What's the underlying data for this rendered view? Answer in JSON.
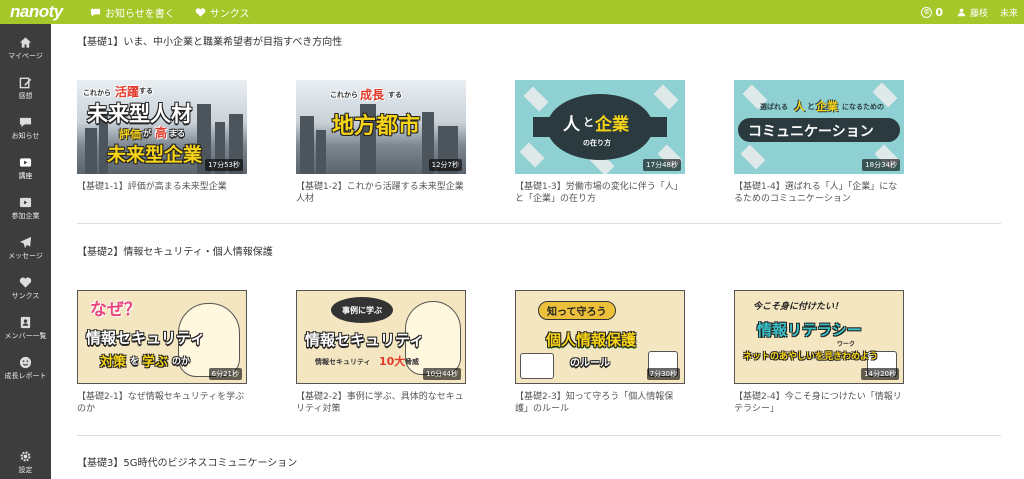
{
  "header": {
    "logo": "nanoty",
    "post_notice": "お知らせを書く",
    "thanks": "サンクス",
    "coin_symbol": "©",
    "coins": "0",
    "user_name": "藤枝",
    "user_extra": "未来"
  },
  "sidebar": {
    "items": [
      {
        "label": "マイページ",
        "icon": "home-icon"
      },
      {
        "label": "感想",
        "icon": "edit-icon"
      },
      {
        "label": "お知らせ",
        "icon": "chat-icon"
      },
      {
        "label": "講座",
        "icon": "play-icon"
      },
      {
        "label": "参加企業",
        "icon": "building-icon"
      },
      {
        "label": "メッセージ",
        "icon": "paper-plane-icon"
      },
      {
        "label": "サンクス",
        "icon": "heart-icon"
      },
      {
        "label": "メンバー一覧",
        "icon": "address-book-icon"
      },
      {
        "label": "成長レポート",
        "icon": "smile-icon"
      },
      {
        "label": "設定",
        "icon": "gear-icon"
      }
    ]
  },
  "sections": [
    {
      "title": "【基礎1】いま、中小企業と職業希望者が目指すべき方向性",
      "courses": [
        {
          "title": "【基礎1-1】評価が高まる未来型企業",
          "duration": "17分53秒",
          "thumb": {
            "small1": "これから",
            "accent1": "活躍",
            "small2": "する",
            "main1": "未来型人材",
            "accent2": "評価",
            "small3": "が",
            "accent3": "高",
            "small4": "まる",
            "main2": "未来型企業"
          }
        },
        {
          "title": "【基礎1-2】これから活躍する未来型企業人材",
          "duration": "12分7秒",
          "thumb": {
            "small1": "これから",
            "accent1": "成長",
            "small2": "する",
            "main1": "地方都市"
          }
        },
        {
          "title": "【基礎1-3】労働市場の変化に伴う「人」と「企業」の在り方",
          "duration": "17分48秒",
          "thumb": {
            "main1a": "人",
            "main1b": "と",
            "main1c": "企業",
            "sub": "の在り方"
          }
        },
        {
          "title": "【基礎1-4】選ばれる「人」「企業」になるためのコミュニケーション",
          "duration": "18分34秒",
          "thumb": {
            "pre": "選ばれる",
            "a": "人",
            "b": "と",
            "c": "企業",
            "post": "になるための",
            "main": "コミュニケーション"
          }
        }
      ]
    },
    {
      "title": "【基礎2】情報セキュリティ・個人情報保護",
      "courses": [
        {
          "title": "【基礎2-1】なぜ情報セキュリティを学ぶのか",
          "duration": "6分21秒",
          "thumb": {
            "q": "なぜ？",
            "main": "情報セキュリティ",
            "b1": "対策",
            "b2": "を",
            "b3": "学ぶ",
            "b4": "のか"
          }
        },
        {
          "title": "【基礎2-2】事例に学ぶ、具体的なセキュリティ対策",
          "duration": "10分44秒",
          "thumb": {
            "bubble": "事例に学ぶ",
            "main": "情報セキュリティ",
            "sub": "情報セキュリティ",
            "num": "10大",
            "sub2": "脅威"
          }
        },
        {
          "title": "【基礎2-3】知って守ろう「個人情報保護」のルール",
          "duration": "7分30秒",
          "thumb": {
            "pill": "知って守ろう",
            "main": "個人情報保護",
            "sub": "のルール"
          }
        },
        {
          "title": "【基礎2-4】今こそ身につけたい「情報リテラシー」",
          "duration": "14分20秒",
          "thumb": {
            "pre": "今こそ身に付けたい！",
            "main": "情報リテラシー",
            "ruby": "ワーク",
            "sub": "ネットのあやしいを見きわめよう"
          }
        }
      ]
    },
    {
      "title": "【基礎3】5G時代のビジネスコミュニケーション",
      "courses": []
    }
  ],
  "colors": {
    "brand": "#a6c729",
    "sidebar": "#3d3d3d",
    "accent_yellow": "#f7d417",
    "teal": "#8fd1d3",
    "paper": "#f4e6c1"
  }
}
